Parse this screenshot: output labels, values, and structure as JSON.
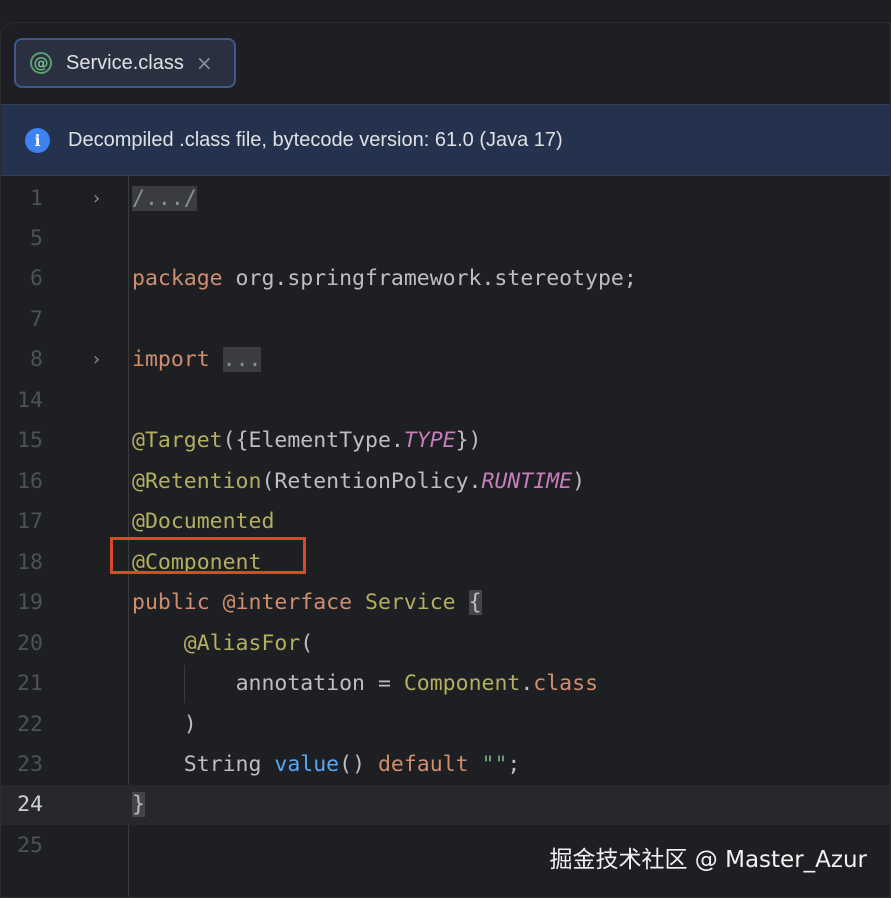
{
  "tab": {
    "icon": "annotation-icon",
    "label": "Service.class",
    "close": "×"
  },
  "banner": {
    "icon": "info-icon",
    "text": "Decompiled .class file, bytecode version: 61.0 (Java 17)"
  },
  "lines": {
    "n1": "1",
    "t1": "/.../",
    "n5": "5",
    "n6": "6",
    "t6_kw": "package",
    "t6_rest": " org.springframework.stereotype;",
    "n7": "7",
    "n8": "8",
    "t8_kw": "import",
    "t8_fold": "...",
    "n14": "14",
    "n15": "15",
    "t15_ann": "@Target",
    "t15_a": "({ElementType.",
    "t15_i": "TYPE",
    "t15_b": "})",
    "n16": "16",
    "t16_ann": "@Retention",
    "t16_a": "(RetentionPolicy.",
    "t16_i": "RUNTIME",
    "t16_b": ")",
    "n17": "17",
    "t17_ann": "@Documented",
    "n18": "18",
    "t18_ann": "@Component",
    "n19": "19",
    "t19_kw1": "public",
    "t19_ann": "@interface",
    "t19_name": " Service ",
    "t19_brace": "{",
    "n20": "20",
    "t20_ann": "@AliasFor",
    "t20_a": "(",
    "n21": "21",
    "t21_a": "annotation = ",
    "t21_cls": "Component",
    "t21_dot": ".",
    "t21_kw": "class",
    "n22": "22",
    "t22_a": ")",
    "n23": "23",
    "t23_a": "String ",
    "t23_fn": "value",
    "t23_b": "() ",
    "t23_kw": "default",
    "t23_str": "\"\"",
    "t23_end": ";",
    "n24": "24",
    "t24_brace": "}",
    "n25": "25"
  },
  "current_line": "24",
  "watermark": "掘金技术社区 @ Master_Azur"
}
